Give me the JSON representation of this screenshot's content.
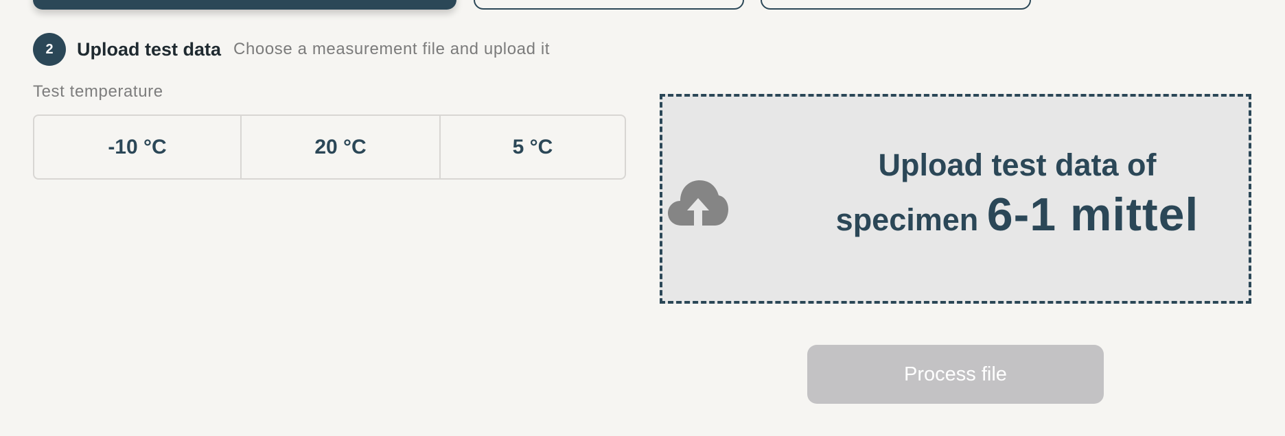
{
  "step": {
    "number": "2",
    "title": "Upload test data",
    "subtitle": "Choose a measurement file and upload it"
  },
  "temperature": {
    "label": "Test temperature",
    "options": [
      "-10 °C",
      "20 °C",
      "5 °C"
    ]
  },
  "dropzone": {
    "line1": "Upload test data of",
    "line2_prefix": "specimen",
    "specimen": "6-1 mittel",
    "icon": "cloud-upload-icon"
  },
  "actions": {
    "process_label": "Process file",
    "process_enabled": false
  },
  "colors": {
    "primary": "#2b4757",
    "background": "#f6f5f2",
    "dropzone_bg": "#e7e7e7",
    "disabled_button": "#c3c2c4",
    "icon_gray": "#858585"
  }
}
